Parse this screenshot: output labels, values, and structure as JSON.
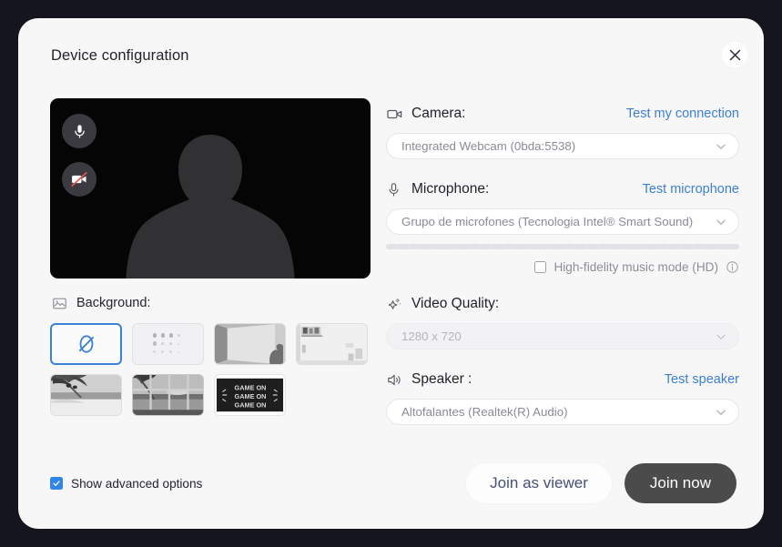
{
  "dialog": {
    "title": "Device configuration",
    "close_label": "×"
  },
  "preview": {
    "mic_icon": "microphone-icon",
    "mic_state": "on",
    "camera_icon": "camera-off-icon",
    "camera_state": "off",
    "avatar": "person-silhouette"
  },
  "background": {
    "label": "Background:",
    "icon": "image-icon",
    "options": [
      {
        "name": "none",
        "kind": "none",
        "selected": true
      },
      {
        "name": "blur",
        "kind": "blur",
        "selected": false
      },
      {
        "name": "room-corner",
        "kind": "photo",
        "selected": false
      },
      {
        "name": "bright-shelf",
        "kind": "photo",
        "selected": false
      },
      {
        "name": "beach-palms",
        "kind": "photo",
        "selected": false
      },
      {
        "name": "window-beach",
        "kind": "photo",
        "selected": false
      },
      {
        "name": "game-on",
        "kind": "photo",
        "selected": false,
        "caption": "GAME ON"
      }
    ]
  },
  "camera": {
    "icon": "camera-icon",
    "label": "Camera:",
    "link": "Test my connection",
    "value": "Integrated Webcam (0bda:5538)"
  },
  "microphone": {
    "icon": "microphone-icon",
    "label": "Microphone:",
    "link": "Test microphone",
    "value": "Grupo de microfones (Tecnologia Intel® Smart Sound)",
    "level": 0,
    "hifi": {
      "label": "High-fidelity music mode (HD)",
      "checked": false,
      "info_icon": "info-icon"
    }
  },
  "video_quality": {
    "icon": "sparkle-star-icon",
    "label": "Video Quality:",
    "value": "1280 x 720",
    "disabled": true
  },
  "speaker": {
    "icon": "speaker-icon",
    "label": "Speaker :",
    "link": "Test speaker",
    "value": "Altofalantes (Realtek(R) Audio)"
  },
  "footer": {
    "advanced_label": "Show advanced options",
    "advanced_checked": true,
    "join_viewer_label": "Join as viewer",
    "join_now_label": "Join now"
  },
  "colors": {
    "accent_link": "#3b7fd4",
    "selected_border": "#3b82d6",
    "join_now_bg": "#4b4b4b",
    "join_viewer_text": "#474f7a",
    "checkbox_checked": "#2f86e8",
    "canvas_bg": "#14151f",
    "dialog_bg": "#f7f7f8"
  }
}
